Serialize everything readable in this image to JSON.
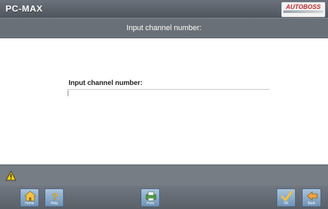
{
  "header": {
    "brand": "PC-MAX",
    "logo": "AUTOBOSS"
  },
  "title": "Input channel number:",
  "form": {
    "label": "Input channel number:",
    "value": ""
  },
  "status": {
    "icon": "warning-icon"
  },
  "toolbar": {
    "buttons": [
      {
        "label": "Home",
        "icon": "home-icon"
      },
      {
        "label": "Help",
        "icon": "help-icon"
      },
      {
        "label": "Print",
        "icon": "print-icon"
      },
      {
        "label": "OK",
        "icon": "check-icon"
      },
      {
        "label": "Back",
        "icon": "back-icon"
      }
    ]
  },
  "colors": {
    "chrome": "#6a7077",
    "button": "#7fa0c0",
    "warning": "#f5d000"
  }
}
